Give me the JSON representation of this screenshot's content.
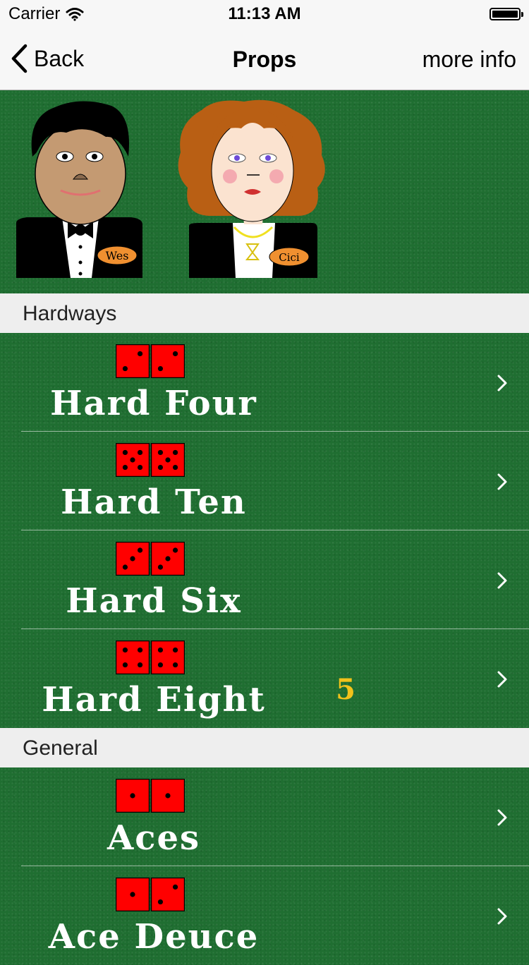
{
  "status_bar": {
    "carrier": "Carrier",
    "time": "11:13 AM"
  },
  "nav": {
    "back_label": "Back",
    "title": "Props",
    "right_label": "more info"
  },
  "dealers": [
    {
      "name": "Wes"
    },
    {
      "name": "Cici"
    }
  ],
  "sections": [
    {
      "title": "Hardways",
      "items": [
        {
          "label": "Hard Four",
          "dice": [
            2,
            2
          ],
          "badge": ""
        },
        {
          "label": "Hard Ten",
          "dice": [
            5,
            5
          ],
          "badge": ""
        },
        {
          "label": "Hard Six",
          "dice": [
            3,
            3
          ],
          "badge": ""
        },
        {
          "label": "Hard Eight",
          "dice": [
            4,
            4
          ],
          "badge": "5"
        }
      ]
    },
    {
      "title": "General",
      "items": [
        {
          "label": "Aces",
          "dice": [
            1,
            1
          ],
          "badge": ""
        },
        {
          "label": "Ace Deuce",
          "dice": [
            1,
            2
          ],
          "badge": ""
        }
      ]
    }
  ],
  "colors": {
    "felt": "#1f6e31",
    "die": "#ff0000",
    "badge": "#f2c21b",
    "nav_bg": "#f7f7f7",
    "section_bg": "#eeeeee"
  }
}
